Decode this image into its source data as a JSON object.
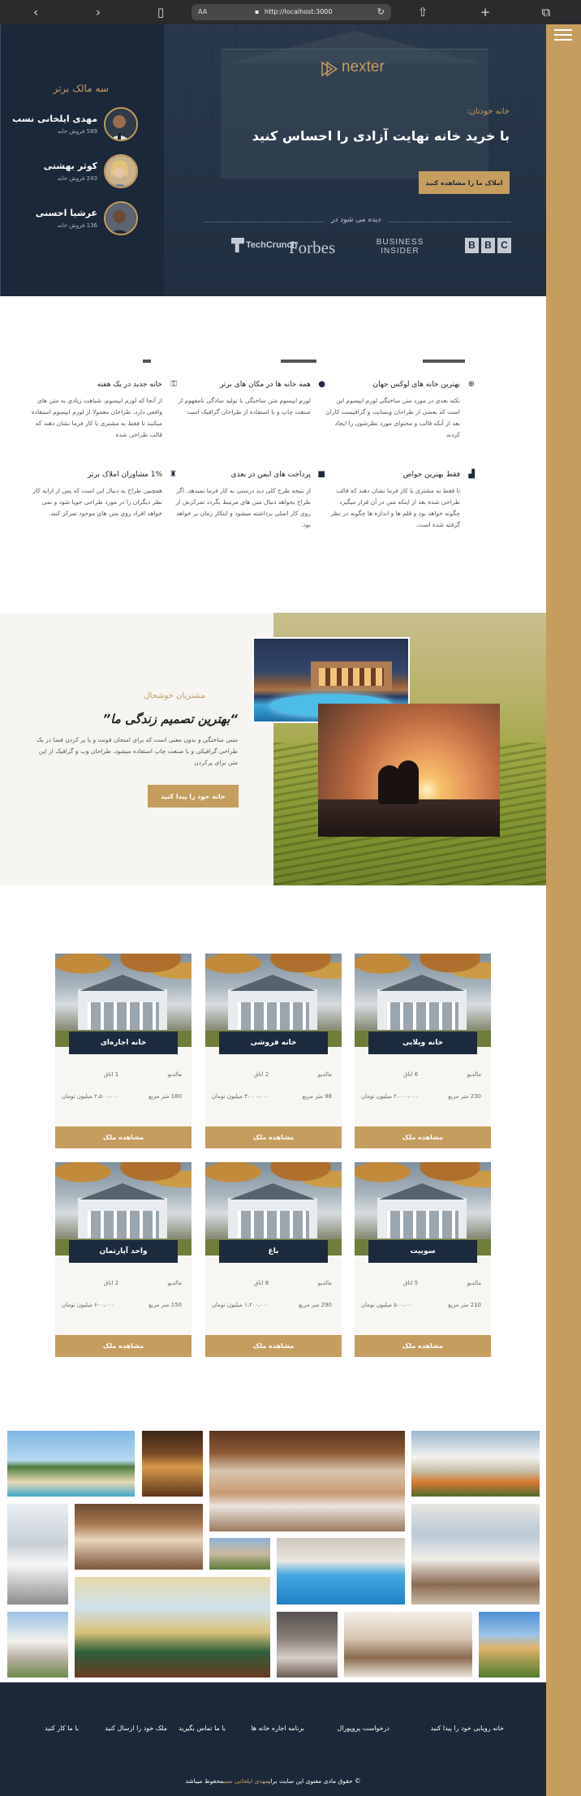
{
  "browser": {
    "text_size_label": "AA",
    "url": "http://localhost:3000"
  },
  "hero": {
    "logo_text": "nexter",
    "kicker": "خانه خودتان:",
    "title": "با خرید خانه نهایت آزادی را احساس کنید",
    "cta": "املاک ما را مشاهده کنید",
    "seen_on": "دیده می شود در",
    "press": [
      "TechCrunch",
      "Forbes",
      "BUSINESS INSIDER",
      "BBC"
    ]
  },
  "owners": {
    "title": "سه مالک برتر",
    "list": [
      {
        "name": "مهدی ایلخانی نسب",
        "sales": "589 فروش خانه"
      },
      {
        "name": "کوثر بهشتی",
        "sales": "243 فروش خانه"
      },
      {
        "name": "عرشیا احسنی",
        "sales": "136 فروش خانه"
      }
    ]
  },
  "features": [
    {
      "title": "بهترین خانه های لوکس جهان",
      "desc": "نکته بعدی در مورد متن ساختگی لورم ایپسوم این است که بعضی از طراحان وبسایت و گرافیست کاران بعد از آنکه قالب و محتوای مورد نظرشون را ایجاد کردند",
      "icon": "globe-icon"
    },
    {
      "title": "همه خانه ها در مکان های برتر",
      "desc": "لورم ایپسوم متن ساختگی با تولید سادگی نامفهوم از صنعت چاپ و با استفاده از طراحان گرافیک است",
      "icon": "map-pin-icon"
    },
    {
      "title": "خانه جدید در یک هفته",
      "desc": "از آنجا که لورم ایپسوم، شباهت زیادی به متن های واقعی دارد، طراحان معمولا از لورم ایپسوم استفاده میکنند تا فقط به مشتری یا کار فرما نشان دهند که قالب طراحی شده",
      "icon": "key-icon"
    },
    {
      "title": "فقط بهترین خواص",
      "desc": "تا فقط به مشتری یا کار فرما نشان دهند که قالب طراحی شده بعد از اینکه متن در آن قرار میگیرد چگونه خواهد بود و قلم ها و اندازه ها چگونه در نظر گرفته شده است.",
      "icon": "chart-icon"
    },
    {
      "title": "پرداخت های ایمن در بعدی",
      "desc": "از نتیجه طرح کلی دید درستی به کار فرما نمیدهد. اگر طراح بخواهد دنبال متن های مرتبط بگردد تمرکزش از روی کار اصلی برداشته میشود و اینکار زمان بر خواهد بود.",
      "icon": "lock-icon"
    },
    {
      "title": "1% مشاوران املاک برتر",
      "desc": "همچنین طراح به دنبال این است که پس از ارایه کار نظر دیگران را در مورد طراحی جویا شود و نمی خواهد افراد روی متن های موجود تمرکز کنند.",
      "icon": "trophy-icon"
    }
  ],
  "happy": {
    "kicker": "مشتریان خوشحال",
    "title": "“بهترین تصمیم زندگی ما”",
    "desc": "متنی ساختگی و بدون معنی است که برای امتحان فونت و یا پر کردن فضا در یک طراحی گرافیکی و یا صنعت چاپ استفاده میشود. طراحان وب و گرافیک از این متن برای پرکردن",
    "cta": "خانه خود را پیدا کنید"
  },
  "properties": {
    "meters_label": "مالدیو",
    "button_label": "مشاهده ملک",
    "items": [
      {
        "name": "خانه ویلایی",
        "rooms": "6 اتاق",
        "area": "230 متر مربع",
        "price": "۲،۰۰۰،۰۰۰ میلیون تومان"
      },
      {
        "name": "خانه فروشی",
        "rooms": "2 اتاق",
        "area": "98 متر مربع",
        "price": "۳،۰۰۰،۰۰۰ میلیون تومان"
      },
      {
        "name": "خانه اجاره‌ای",
        "rooms": "1 اتاق",
        "area": "180 متر مربع",
        "price": "۲،۵۰۰،۰۰۰ میلیون تومان"
      },
      {
        "name": "سوییت",
        "rooms": "5 اتاق",
        "area": "210 متر مربع",
        "price": "۵۰۰،۰۰۰ میلیون تومان"
      },
      {
        "name": "باغ",
        "rooms": "8 اتاق",
        "area": "290 متر مربع",
        "price": "۱،۲۰۰،۰۰۰ میلیون تومان"
      },
      {
        "name": "واحد آپارتمان",
        "rooms": "2 اتاق",
        "area": "150 متر مربع",
        "price": "۶۰۰،۰۰۰ میلیون تومان"
      }
    ]
  },
  "footer": {
    "links": [
      "خانه رویایی خود را پیدا کنید",
      "درخواست پروپوزال",
      "برنامه اجاره خانه ها",
      "با ما تماس بگیرید",
      "ملک خود را ارسال کنید",
      "با ما کار کنید"
    ],
    "copyright_prefix": "© حقوق مادی معنوی این سایت برای",
    "copyright_name": "مهدی ایلخانی نسب",
    "copyright_suffix": "محفوظ میباشد"
  },
  "colors": {
    "accent": "#c59d5f",
    "navy": "#1c2a3d"
  }
}
